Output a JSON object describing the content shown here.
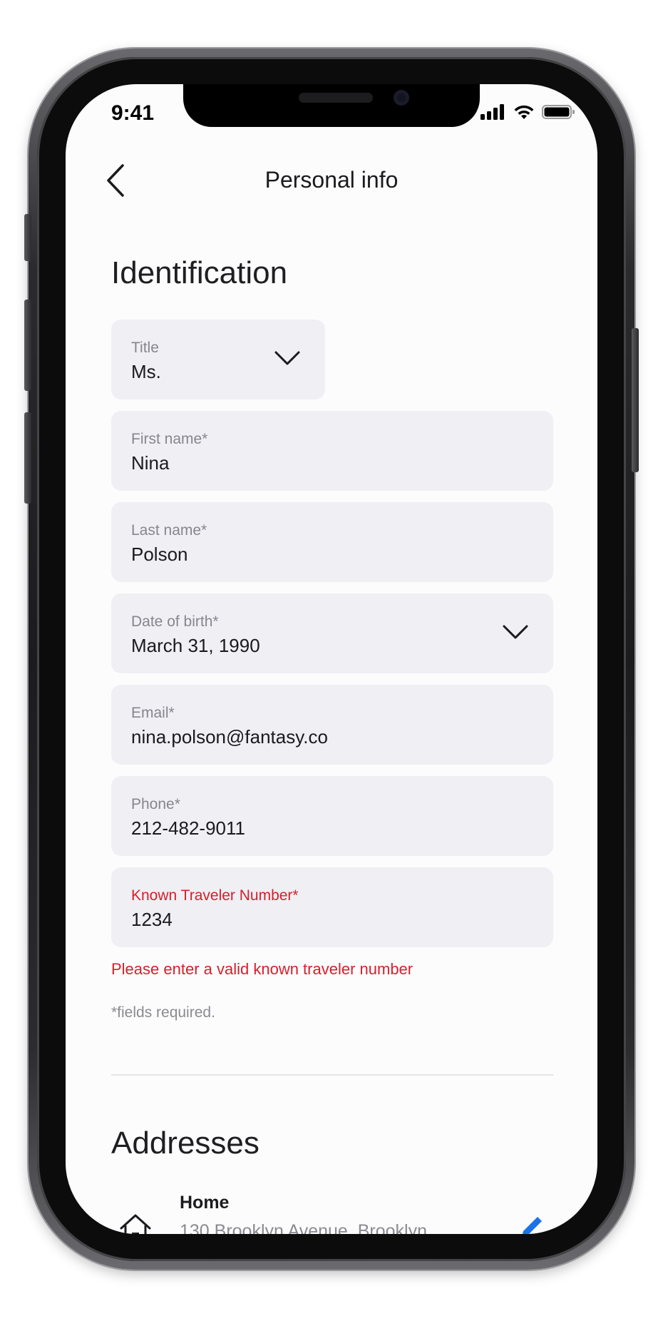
{
  "status_bar": {
    "time": "9:41"
  },
  "nav": {
    "title": "Personal info"
  },
  "identification": {
    "heading": "Identification",
    "fields": {
      "title": {
        "label": "Title",
        "value": "Ms."
      },
      "first_name": {
        "label": "First name*",
        "value": "Nina"
      },
      "last_name": {
        "label": "Last name*",
        "value": "Polson"
      },
      "dob": {
        "label": "Date of birth*",
        "value": "March 31, 1990"
      },
      "email": {
        "label": "Email*",
        "value": "nina.polson@fantasy.co"
      },
      "phone": {
        "label": "Phone*",
        "value": "212-482-9011"
      },
      "ktn": {
        "label": "Known Traveler Number*",
        "value": "1234"
      }
    },
    "error": "Please enter a valid known traveler number",
    "required_note": "*fields required."
  },
  "addresses": {
    "heading": "Addresses",
    "items": [
      {
        "name": "Home",
        "line": "130 Brooklyn Avenue, Brooklyn"
      }
    ]
  },
  "colors": {
    "error": "#d6202b",
    "accent": "#1a73e8",
    "field_bg": "#efeff4"
  }
}
